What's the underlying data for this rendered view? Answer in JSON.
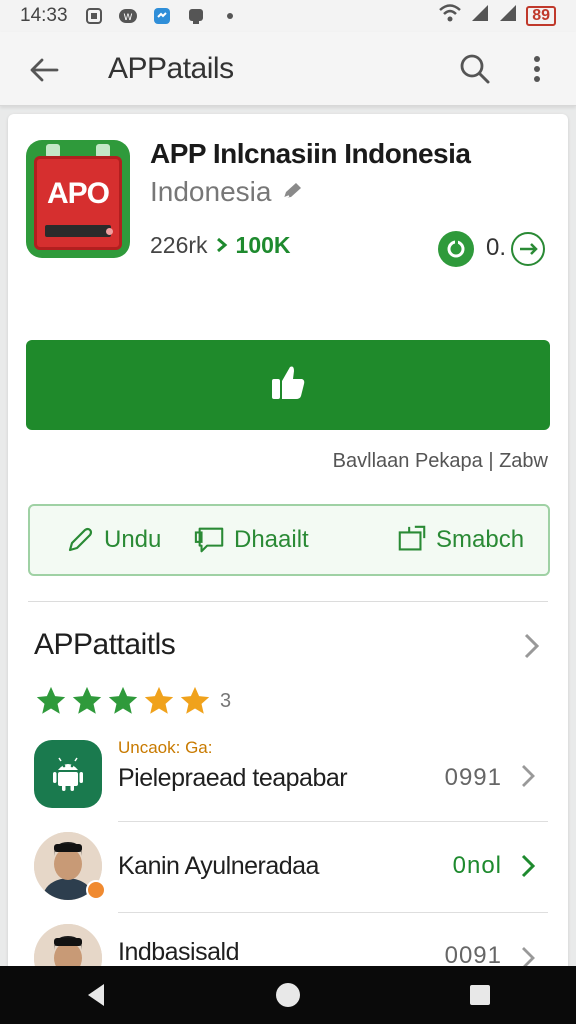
{
  "status_bar": {
    "time": "14:33",
    "battery": "89"
  },
  "app_bar": {
    "title": "APPatails"
  },
  "app": {
    "name": "APP Inlcnasiin Indonesia",
    "developer": "Indonesia",
    "icon_text": "APO",
    "size": "226rk",
    "downloads": "100K",
    "rating_value": "0."
  },
  "install_caption": "Bavllaan Pekapa | Zabw",
  "actions": [
    {
      "label": "Undu",
      "icon": "pencil-icon"
    },
    {
      "label": "Dhaailt",
      "icon": "chat-bubble-icon"
    },
    {
      "label": "Smabch",
      "icon": "share-icon"
    }
  ],
  "section": {
    "title": "APPattaitls",
    "rating_count": "3",
    "star_rating": 5
  },
  "rows": [
    {
      "sub": "Uncaok: Ga:",
      "label": "Pielepraead teapabar",
      "value": "0991"
    },
    {
      "label": "Kanin Ayulneradaa",
      "value": "0nol"
    },
    {
      "label": "Indbasisald",
      "value": "0091"
    }
  ],
  "colors": {
    "primary_green": "#1f8a2b",
    "accent_orange": "#f0a21c"
  }
}
